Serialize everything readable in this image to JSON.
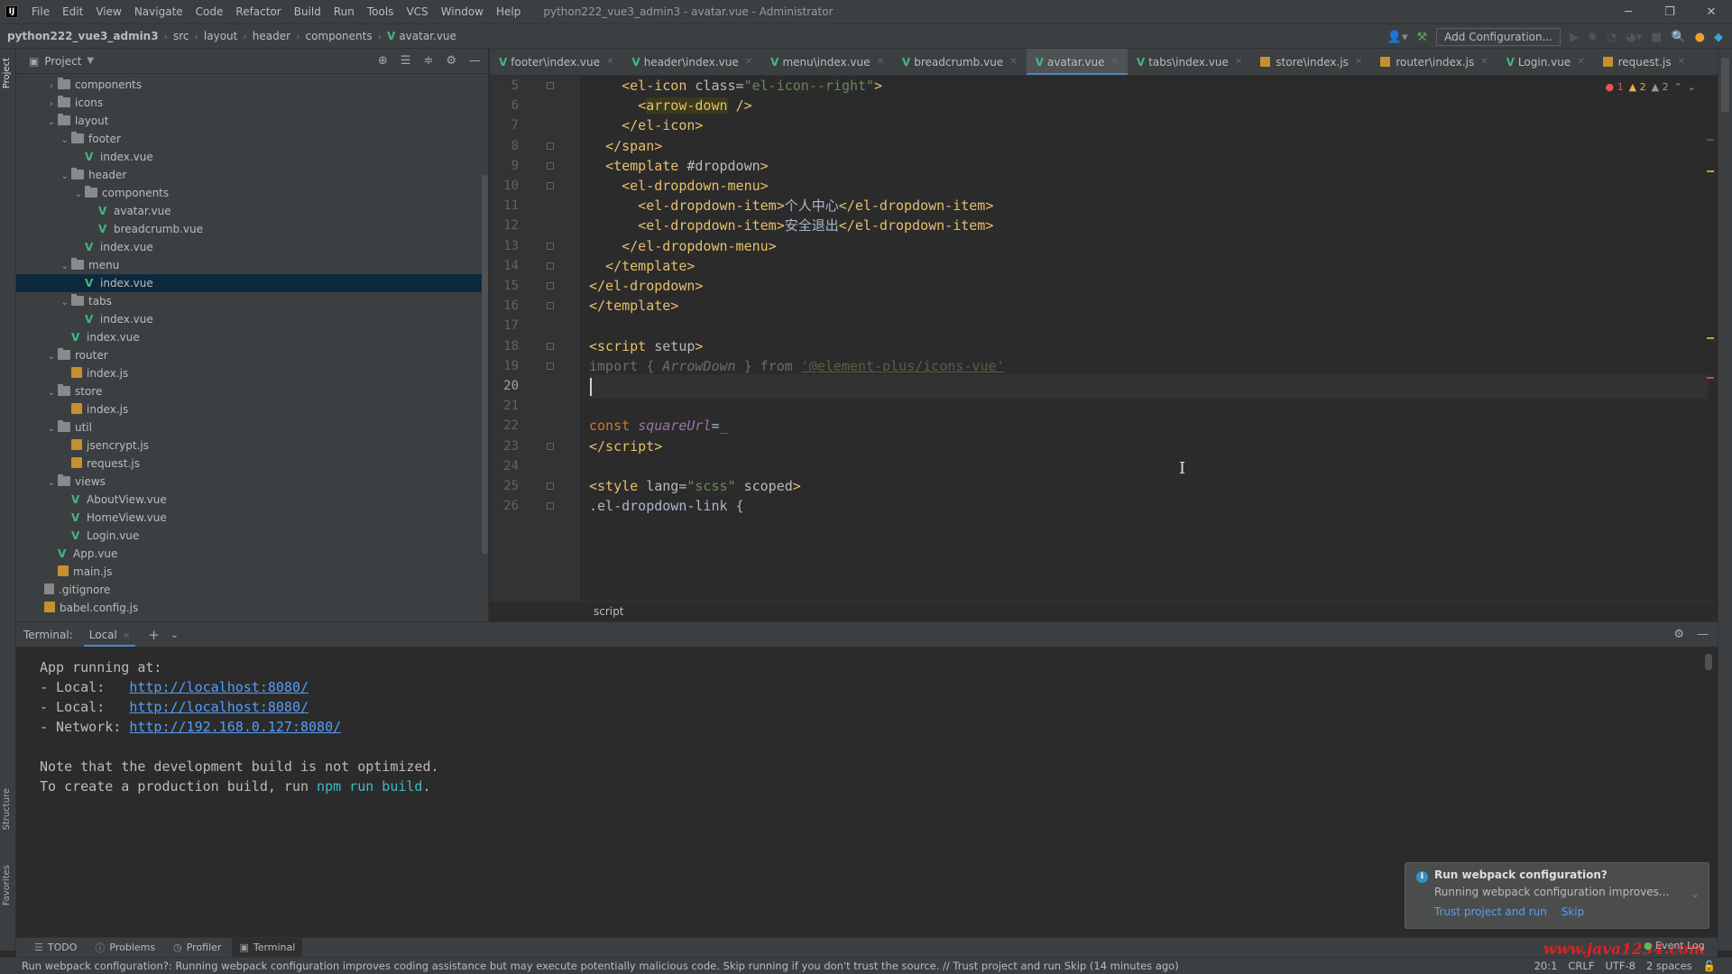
{
  "app": {
    "logo": "IJ",
    "menu": [
      "File",
      "Edit",
      "View",
      "Navigate",
      "Code",
      "Refactor",
      "Build",
      "Run",
      "Tools",
      "VCS",
      "Window",
      "Help"
    ],
    "window_title": "python222_vue3_admin3 - avatar.vue - Administrator"
  },
  "navbar": {
    "crumbs": [
      "python222_vue3_admin3",
      "src",
      "layout",
      "header",
      "components",
      "avatar.vue"
    ],
    "add_configuration": "Add Configuration..."
  },
  "left_stripe": {
    "project": "Project",
    "structure": "Structure",
    "favorites": "Favorites"
  },
  "project_panel": {
    "title": "Project",
    "tree": [
      {
        "label": "components",
        "type": "folder",
        "depth": 2,
        "expanded": false
      },
      {
        "label": "icons",
        "type": "folder",
        "depth": 2,
        "expanded": false
      },
      {
        "label": "layout",
        "type": "folder",
        "depth": 2,
        "expanded": true
      },
      {
        "label": "footer",
        "type": "folder",
        "depth": 3,
        "expanded": true
      },
      {
        "label": "index.vue",
        "type": "vue",
        "depth": 4
      },
      {
        "label": "header",
        "type": "folder",
        "depth": 3,
        "expanded": true
      },
      {
        "label": "components",
        "type": "folder",
        "depth": 4,
        "expanded": true
      },
      {
        "label": "avatar.vue",
        "type": "vue",
        "depth": 5
      },
      {
        "label": "breadcrumb.vue",
        "type": "vue",
        "depth": 5
      },
      {
        "label": "index.vue",
        "type": "vue",
        "depth": 4
      },
      {
        "label": "menu",
        "type": "folder",
        "depth": 3,
        "expanded": true
      },
      {
        "label": "index.vue",
        "type": "vue",
        "depth": 4,
        "selected": true
      },
      {
        "label": "tabs",
        "type": "folder",
        "depth": 3,
        "expanded": true
      },
      {
        "label": "index.vue",
        "type": "vue",
        "depth": 4
      },
      {
        "label": "index.vue",
        "type": "vue",
        "depth": 3
      },
      {
        "label": "router",
        "type": "folder",
        "depth": 2,
        "expanded": true
      },
      {
        "label": "index.js",
        "type": "js",
        "depth": 3
      },
      {
        "label": "store",
        "type": "folder",
        "depth": 2,
        "expanded": true
      },
      {
        "label": "index.js",
        "type": "js",
        "depth": 3
      },
      {
        "label": "util",
        "type": "folder",
        "depth": 2,
        "expanded": true
      },
      {
        "label": "jsencrypt.js",
        "type": "js",
        "depth": 3
      },
      {
        "label": "request.js",
        "type": "js",
        "depth": 3
      },
      {
        "label": "views",
        "type": "folder",
        "depth": 2,
        "expanded": true
      },
      {
        "label": "AboutView.vue",
        "type": "vue",
        "depth": 3
      },
      {
        "label": "HomeView.vue",
        "type": "vue",
        "depth": 3
      },
      {
        "label": "Login.vue",
        "type": "vue",
        "depth": 3
      },
      {
        "label": "App.vue",
        "type": "vue",
        "depth": 2
      },
      {
        "label": "main.js",
        "type": "js",
        "depth": 2
      },
      {
        "label": ".gitignore",
        "type": "file",
        "depth": 1
      },
      {
        "label": "babel.config.js",
        "type": "js",
        "depth": 1
      }
    ]
  },
  "editor_tabs": [
    {
      "label": "footer\\index.vue",
      "type": "vue"
    },
    {
      "label": "header\\index.vue",
      "type": "vue"
    },
    {
      "label": "menu\\index.vue",
      "type": "vue"
    },
    {
      "label": "breadcrumb.vue",
      "type": "vue"
    },
    {
      "label": "avatar.vue",
      "type": "vue",
      "active": true
    },
    {
      "label": "tabs\\index.vue",
      "type": "vue"
    },
    {
      "label": "store\\index.js",
      "type": "js"
    },
    {
      "label": "router\\index.js",
      "type": "js"
    },
    {
      "label": "Login.vue",
      "type": "vue"
    },
    {
      "label": "request.js",
      "type": "js"
    }
  ],
  "editor": {
    "inspections": {
      "errors": "1",
      "warnings": "2",
      "weak": "2"
    },
    "current_line": "20",
    "lines": [
      {
        "n": "5",
        "html": "    <span class='tag'>&lt;el-icon</span> <span class='attr'>class=</span><span class='str'>\"el-icon--right\"</span><span class='tag'>&gt;</span>"
      },
      {
        "n": "6",
        "html": "      <span class='tag'>&lt;<span class='hl'>arrow-down</span></span> <span class='tag'>/&gt;</span>"
      },
      {
        "n": "7",
        "html": "    <span class='tag'>&lt;/el-icon&gt;</span>"
      },
      {
        "n": "8",
        "html": "  <span class='tag'>&lt;/span&gt;</span>"
      },
      {
        "n": "9",
        "html": "  <span class='tag'>&lt;template</span> <span class='attr'>#dropdown</span><span class='tag'>&gt;</span>"
      },
      {
        "n": "10",
        "html": "    <span class='tag'>&lt;el-dropdown-menu&gt;</span>"
      },
      {
        "n": "11",
        "html": "      <span class='tag'>&lt;el-dropdown-item&gt;</span>个人中心<span class='tag'>&lt;/el-dropdown-item&gt;</span>"
      },
      {
        "n": "12",
        "html": "      <span class='tag'>&lt;el-dropdown-item&gt;</span>安全退出<span class='tag'>&lt;/el-dropdown-item&gt;</span>"
      },
      {
        "n": "13",
        "html": "    <span class='tag'>&lt;/el-dropdown-menu&gt;</span>"
      },
      {
        "n": "14",
        "html": "  <span class='tag'>&lt;/template&gt;</span>"
      },
      {
        "n": "15",
        "html": "<span class='tag'>&lt;/el-dropdown&gt;</span>"
      },
      {
        "n": "16",
        "html": "<span class='tag'>&lt;/template&gt;</span>"
      },
      {
        "n": "17",
        "html": ""
      },
      {
        "n": "18",
        "html": "<span class='tag'>&lt;script</span> <span class='attr'>setup</span><span class='tag'>&gt;</span>"
      },
      {
        "n": "19",
        "html": "<span class='unused'>import { <span class='it'>ArrowDown</span> } from <span class='u'>'@element-plus/icons-vue'</span></span>"
      },
      {
        "n": "20",
        "html": ""
      },
      {
        "n": "21",
        "html": ""
      },
      {
        "n": "22",
        "html": "<span class='kw'>const</span> <span class='var'>squareUrl</span>=<span class='err'>_</span>"
      },
      {
        "n": "23",
        "html": "<span class='tag'>&lt;/script&gt;</span>"
      },
      {
        "n": "24",
        "html": ""
      },
      {
        "n": "25",
        "html": "<span class='tag'>&lt;style</span> <span class='attr'>lang=</span><span class='str'>\"scss\"</span> <span class='attr'>scoped</span><span class='tag'>&gt;</span>"
      },
      {
        "n": "26",
        "html": ".el-dropdown-link {"
      }
    ],
    "footer_crumb": "script"
  },
  "terminal": {
    "label": "Terminal:",
    "tab": "Local",
    "lines": [
      {
        "text": "App running at:"
      },
      {
        "prefix": "- Local:   ",
        "link": "http://localhost:8080/"
      },
      {
        "prefix": "- Local:   ",
        "link": "http://localhost:8080/"
      },
      {
        "prefix": "- Network: ",
        "link": "http://192.168.0.127:8080/"
      },
      {
        "text": ""
      },
      {
        "text": "Note that the development build is not optimized."
      },
      {
        "text": "To create a production build, run ",
        "cmd": "npm run build",
        "suffix": "."
      }
    ]
  },
  "notification": {
    "title": "Run webpack configuration?",
    "body": "Running webpack configuration improves...",
    "action_trust": "Trust project and run",
    "action_skip": "Skip"
  },
  "tool_windows": [
    {
      "label": "TODO",
      "icon": "list-icon"
    },
    {
      "label": "Problems",
      "icon": "problems-icon"
    },
    {
      "label": "Profiler",
      "icon": "profiler-icon"
    },
    {
      "label": "Terminal",
      "icon": "terminal-icon",
      "active": true
    }
  ],
  "status": {
    "message": "Run webpack configuration?: Running webpack configuration improves coding assistance but may execute potentially malicious code. Skip running if you don't trust the source. // Trust project and run   Skip (14 minutes ago)",
    "position": "20:1",
    "line_sep": "CRLF",
    "encoding": "UTF-8",
    "indent": "2 spaces",
    "event_log": "Event Log",
    "watermark": "www.java1234.com"
  },
  "colors": {
    "accent": "#4a88c7",
    "vue": "#41b883",
    "js": "#c6902f",
    "link": "#589df6"
  }
}
